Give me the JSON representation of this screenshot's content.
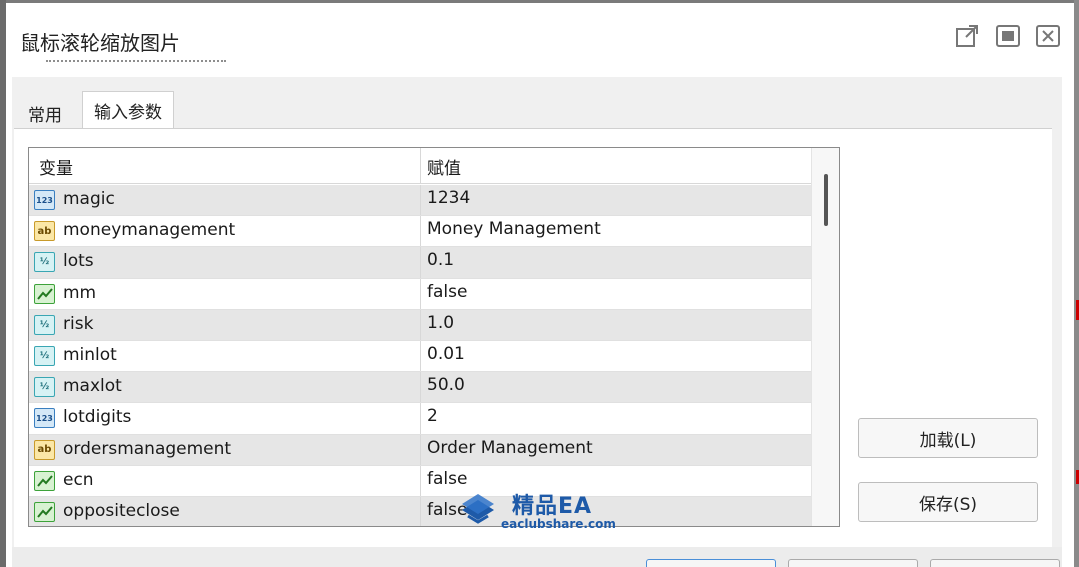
{
  "window": {
    "title": "鼠标滚轮缩放图片"
  },
  "tabs": [
    {
      "label": "常用",
      "active": false
    },
    {
      "label": "输入参数",
      "active": true
    }
  ],
  "table": {
    "headers": {
      "variable": "变量",
      "value": "赋值"
    },
    "rows": [
      {
        "icon": "int-icon",
        "icon_text": "123",
        "name": "magic",
        "value": "1234"
      },
      {
        "icon": "string-icon",
        "icon_text": "ab",
        "name": "moneymanagement",
        "value": "Money Management"
      },
      {
        "icon": "double-icon",
        "icon_text": "½",
        "name": "lots",
        "value": "0.1"
      },
      {
        "icon": "bool-icon",
        "icon_text": "",
        "name": "mm",
        "value": "false"
      },
      {
        "icon": "double-icon",
        "icon_text": "½",
        "name": "risk",
        "value": "1.0"
      },
      {
        "icon": "double-icon",
        "icon_text": "½",
        "name": "minlot",
        "value": "0.01"
      },
      {
        "icon": "double-icon",
        "icon_text": "½",
        "name": "maxlot",
        "value": "50.0"
      },
      {
        "icon": "int-icon",
        "icon_text": "123",
        "name": "lotdigits",
        "value": "2"
      },
      {
        "icon": "string-icon",
        "icon_text": "ab",
        "name": "ordersmanagement",
        "value": "Order Management"
      },
      {
        "icon": "bool-icon",
        "icon_text": "",
        "name": "ecn",
        "value": "false"
      },
      {
        "icon": "bool-icon",
        "icon_text": "",
        "name": "oppositeclose",
        "value": "false"
      }
    ]
  },
  "buttons": {
    "load": "加载(L)",
    "save": "保存(S)"
  },
  "watermark": {
    "title": "精品EA",
    "site": "eaclubshare.com"
  },
  "colors": {
    "int_icon": "#3a7fc0",
    "string_icon": "#c89a2a",
    "double_icon": "#39a6b3",
    "bool_icon": "#3da23a",
    "watermark": "#1e5aa8",
    "alt_row": "#e6e6e6"
  }
}
